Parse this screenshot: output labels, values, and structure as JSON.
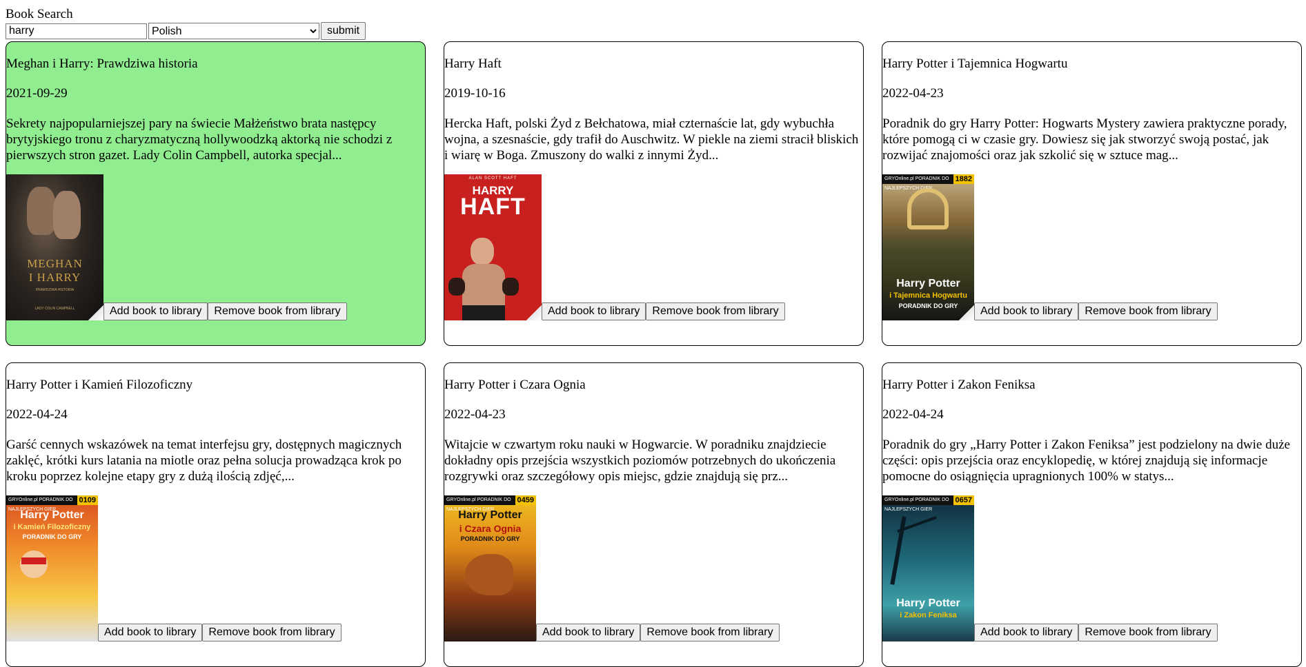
{
  "header": {
    "title": "Book Search"
  },
  "search": {
    "query": "harry",
    "language_selected": "Polish",
    "submit_label": "submit"
  },
  "actions": {
    "add_label": "Add book to library",
    "remove_label": "Remove book from library"
  },
  "colors": {
    "selected_card": "#90ee90"
  },
  "books": [
    {
      "title": "Meghan i Harry: Prawdziwa historia",
      "date": "2021-09-29",
      "description": "Sekrety najpopularniejszej pary na świecie Małżeństwo brata następcy brytyjskiego tronu z charyzmatyczną hollywoodzką aktorką nie schodzi z pierwszych stron gazet. Lady Colin Campbell, autorka specjal...",
      "selected": true,
      "cover": {
        "line1": "MEGHAN",
        "line2": "I HARRY",
        "subtitle": "PRAWDZIWA HISTORIA",
        "author": "LADY COLIN CAMPBELL"
      }
    },
    {
      "title": "Harry Haft",
      "date": "2019-10-16",
      "description": "Hercka Haft, polski Żyd z Bełchatowa, miał czternaście lat, gdy wybuchła wojna, a szesnaście, gdy trafił do Auschwitz. W piekle na ziemi stracił bliskich i wiarę w Boga. Zmuszony do walki z innymi Żyd...",
      "selected": false,
      "cover": {
        "author": "ALAN SCOTT HAFT",
        "line1": "HARRY",
        "line2": "HAFT"
      }
    },
    {
      "title": "Harry Potter i Tajemnica Hogwartu",
      "date": "2022-04-23",
      "description": "Poradnik do gry Harry Potter: Hogwarts Mystery zawiera praktyczne porady, które pomogą ci w czasie gry. Dowiesz się jak stworzyć swoją postać, jak rozwijać znajomości oraz jak szkolić się w sztuce mag...",
      "selected": false,
      "cover": {
        "publisher": "GRYOnline.pl  PORADNIK DO NAJLEPSZYCH GIER",
        "number": "1882",
        "line1": "Harry Potter",
        "line2": "i Tajemnica Hogwartu",
        "subtitle": "PORADNIK DO GRY"
      }
    },
    {
      "title": "Harry Potter i Kamień Filozoficzny",
      "date": "2022-04-24",
      "description": "Garść cennych wskazówek na temat interfejsu gry, dostępnych magicznych zaklęć, krótki kurs latania na miotle oraz pełna solucja prowadząca krok po kroku poprzez kolejne etapy gry z dużą ilością zdjęć,...",
      "selected": false,
      "cover": {
        "publisher": "GRYOnline.pl  PORADNIK DO NAJLEPSZYCH GIER",
        "number": "0109",
        "line1": "Harry Potter",
        "line2": "i Kamień Filozoficzny",
        "subtitle": "PORADNIK DO GRY"
      }
    },
    {
      "title": "Harry Potter i Czara Ognia",
      "date": "2022-04-23",
      "description": "Witajcie w czwartym roku nauki w Hogwarcie. W poradniku znajdziecie dokładny opis przejścia wszystkich poziomów potrzebnych do ukończenia rozgrywki oraz szczegółowy opis miejsc, gdzie znajdują się prz...",
      "selected": false,
      "cover": {
        "publisher": "GRYOnline.pl  PORADNIK DO NAJLEPSZYCH GIER",
        "number": "0459",
        "line1": "Harry Potter",
        "line2": "i Czara Ognia",
        "subtitle": "PORADNIK DO GRY"
      }
    },
    {
      "title": "Harry Potter i Zakon Feniksa",
      "date": "2022-04-24",
      "description": "Poradnik do gry „Harry Potter i Zakon Feniksa” jest podzielony na dwie duże części: opis przejścia oraz encyklopedię, w której znajdują się informacje pomocne do osiągnięcia upragnionych 100% w statys...",
      "selected": false,
      "cover": {
        "publisher": "GRYOnline.pl  PORADNIK DO NAJLEPSZYCH GIER",
        "number": "0657",
        "line1": "Harry Potter",
        "line2": "i Zakon Feniksa"
      }
    }
  ]
}
